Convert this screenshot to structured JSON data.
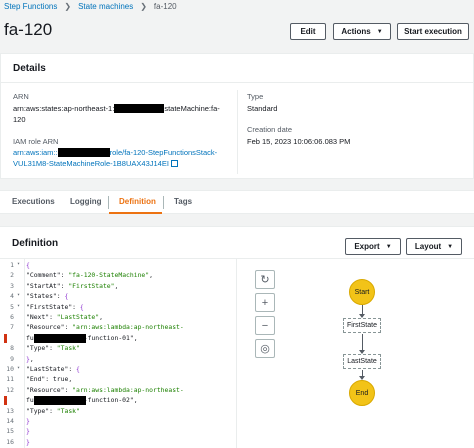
{
  "breadcrumb": {
    "items": [
      "Step Functions",
      "State machines",
      "fa-120"
    ]
  },
  "page_title": "fa-120",
  "header_buttons": {
    "edit": "Edit",
    "actions": "Actions",
    "start_execution": "Start execution"
  },
  "details": {
    "heading": "Details",
    "arn_label": "ARN",
    "arn_prefix": "arn:aws:states:ap-northeast-1:",
    "arn_suffix": "stateMachine:fa-",
    "arn_line2": "120",
    "iam_label": "IAM role ARN",
    "iam_prefix": "arn:aws:iam::",
    "iam_suffix": "role/fa-120-StepFunctionsStack-",
    "iam_line2": "VUL31M8-StateMachineRole-1B8UAX43J14EI",
    "type_label": "Type",
    "type_value": "Standard",
    "created_label": "Creation date",
    "created_value": "Feb 15, 2023 10:06:06.083 PM"
  },
  "tabs": [
    "Executions",
    "Logging",
    "Definition",
    "Tags"
  ],
  "active_tab": "Definition",
  "definition": {
    "heading": "Definition",
    "export_label": "Export",
    "layout_label": "Layout",
    "code_lines": [
      {
        "n": "1",
        "fold": true,
        "text": "{"
      },
      {
        "n": "2",
        "fold": false,
        "text": "  \"Comment\": \"fa-120-StateMachine\","
      },
      {
        "n": "3",
        "fold": false,
        "text": "  \"StartAt\": \"FirstState\","
      },
      {
        "n": "4",
        "fold": true,
        "text": "  \"States\": {"
      },
      {
        "n": "5",
        "fold": true,
        "text": "    \"FirstState\": {"
      },
      {
        "n": "6",
        "fold": false,
        "text": "      \"Next\": \"LastState\","
      },
      {
        "n": "7",
        "fold": false,
        "text": "      \"Resource\": \"arn:aws:lambda:ap-northeast-"
      },
      {
        "n": "",
        "fold": false,
        "text": "                function:fa-120-function-01\","
      },
      {
        "n": "8",
        "fold": false,
        "text": "      \"Type\": \"Task\""
      },
      {
        "n": "9",
        "fold": false,
        "text": "    },"
      },
      {
        "n": "10",
        "fold": true,
        "text": "    \"LastState\": {"
      },
      {
        "n": "11",
        "fold": false,
        "text": "      \"End\": true,"
      },
      {
        "n": "12",
        "fold": false,
        "text": "      \"Resource\": \"arn:aws:lambda:ap-northeast-"
      },
      {
        "n": "",
        "fold": false,
        "text": "                function:fa-120-function-02\","
      },
      {
        "n": "13",
        "fold": false,
        "text": "      \"Type\": \"Task\""
      },
      {
        "n": "14",
        "fold": false,
        "text": "    }"
      },
      {
        "n": "15",
        "fold": false,
        "text": "  }"
      },
      {
        "n": "16",
        "fold": false,
        "text": "}"
      }
    ],
    "graph_controls": [
      "refresh-icon",
      "zoom-in-icon",
      "zoom-out-icon",
      "center-icon"
    ],
    "graph_nodes": {
      "start": "Start",
      "first": "FirstState",
      "last": "LastState",
      "end": "End"
    }
  },
  "colors": {
    "link": "#0073bb",
    "active_tab": "#ec7211",
    "start_end_node": "#f2c318",
    "json_string": "#1d8102",
    "error_marker": "#d13212"
  }
}
